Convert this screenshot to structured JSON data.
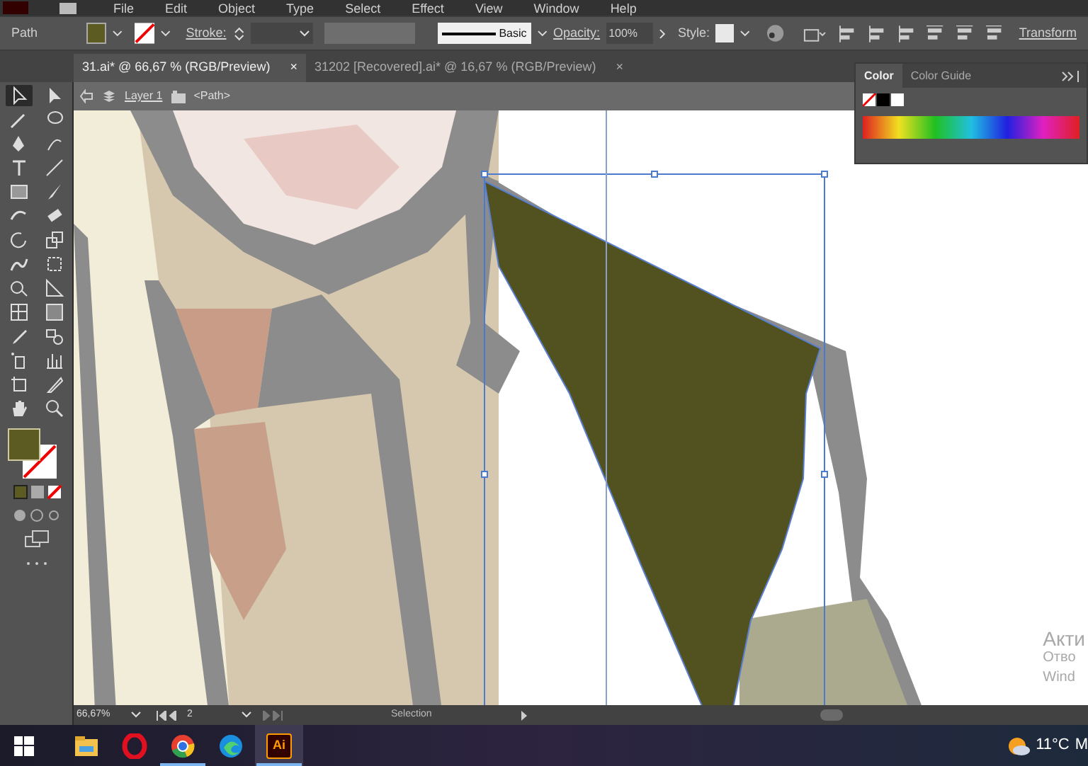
{
  "menu": [
    "File",
    "Edit",
    "Object",
    "Type",
    "Select",
    "Effect",
    "View",
    "Window",
    "Help"
  ],
  "control_bar": {
    "selection_label": "Path",
    "stroke_label": "Stroke:",
    "brush": "Basic",
    "opacity_label": "Opacity:",
    "opacity": "100%",
    "style_label": "Style:",
    "transform": "Transform"
  },
  "tabs": [
    {
      "label": "31.ai* @ 66,67 % (RGB/Preview)",
      "close": "×",
      "selected": true
    },
    {
      "label": "31202 [Recovered].ai* @ 16,67 % (RGB/Preview)",
      "close": "×",
      "selected": false
    }
  ],
  "breadcrumb": {
    "layer": "Layer 1",
    "object": "<Path>"
  },
  "tools": [
    {
      "kind": "selection",
      "selected": true
    },
    {
      "kind": "direct",
      "selected": false
    },
    {
      "kind": "wand",
      "selected": false
    },
    {
      "kind": "lasso",
      "selected": false
    },
    {
      "kind": "pen",
      "selected": false
    },
    {
      "kind": "curvature",
      "selected": false
    },
    {
      "kind": "type",
      "selected": false
    },
    {
      "kind": "line",
      "selected": false
    },
    {
      "kind": "rect",
      "selected": false
    },
    {
      "kind": "brush",
      "selected": false
    },
    {
      "kind": "shaper",
      "selected": false
    },
    {
      "kind": "eraser",
      "selected": false
    },
    {
      "kind": "rotate",
      "selected": false
    },
    {
      "kind": "scale",
      "selected": false
    },
    {
      "kind": "warp",
      "selected": false
    },
    {
      "kind": "transform",
      "selected": false
    },
    {
      "kind": "shapebuilder",
      "selected": false
    },
    {
      "kind": "perspective",
      "selected": false
    },
    {
      "kind": "mesh",
      "selected": false
    },
    {
      "kind": "gradient",
      "selected": false
    },
    {
      "kind": "eyedropper",
      "selected": false
    },
    {
      "kind": "blend",
      "selected": false
    },
    {
      "kind": "spray",
      "selected": false
    },
    {
      "kind": "graph",
      "selected": false
    },
    {
      "kind": "artboard",
      "selected": false
    },
    {
      "kind": "slice",
      "selected": false
    },
    {
      "kind": "hand",
      "selected": false
    },
    {
      "kind": "zoom",
      "selected": false
    }
  ],
  "color_panel": {
    "tabs": [
      {
        "label": "Color",
        "selected": true
      },
      {
        "label": "Color Guide",
        "selected": false
      }
    ]
  },
  "status_bar": {
    "zoom": "66,67%",
    "artboard": "2",
    "tool": "Selection"
  },
  "activation_notice": [
    "Акти",
    "Отво",
    "Wind"
  ],
  "taskbar": {
    "apps": [
      {
        "kind": "explorer",
        "running": false
      },
      {
        "kind": "opera",
        "running": false
      },
      {
        "kind": "chrome",
        "running": true
      },
      {
        "kind": "edge",
        "running": false
      },
      {
        "kind": "illustrator",
        "label": "Ai",
        "running": true
      }
    ],
    "temperature": "11°C",
    "tray_text": "M"
  }
}
